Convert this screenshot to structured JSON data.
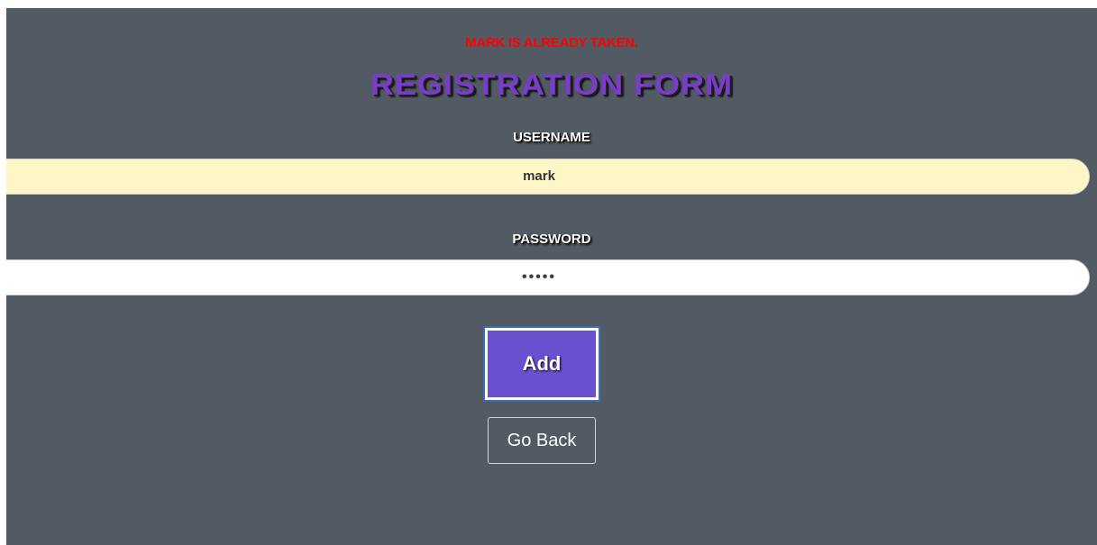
{
  "error": {
    "message": "MARK IS ALREADY TAKEN.",
    "color": "#ff0000"
  },
  "form": {
    "title": "REGISTRATION FORM",
    "username_label": "USERNAME",
    "username_value": "mark",
    "password_label": "PASSWORD",
    "password_masked": "•••••",
    "add_label": "Add",
    "back_label": "Go Back"
  },
  "colors": {
    "background": "#525a64",
    "title": "#7a3cc9",
    "username_field": "#fff6c8",
    "password_field": "#ffffff",
    "add_button": "#6a4fcf"
  }
}
